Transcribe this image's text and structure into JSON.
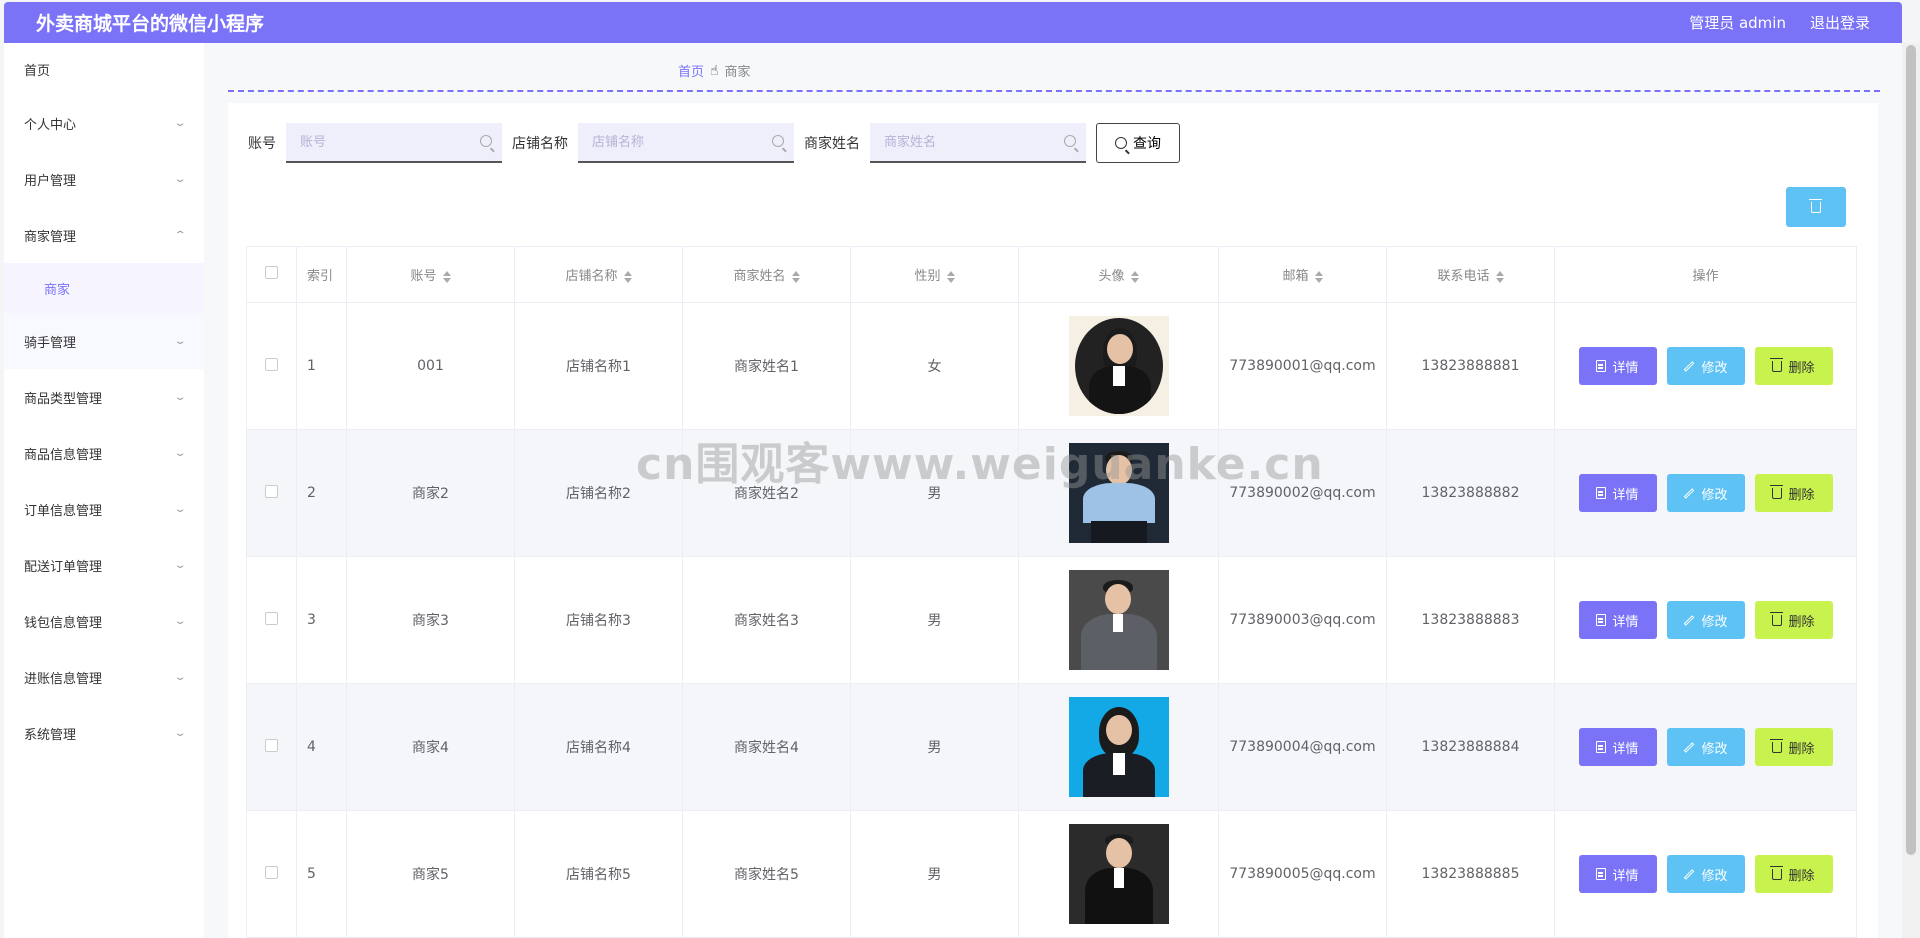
{
  "app": {
    "title": "外卖商城平台的微信小程序"
  },
  "header": {
    "user": "管理员 admin",
    "logout": "退出登录"
  },
  "sidebar": {
    "items": [
      {
        "label": "首页",
        "expandable": false
      },
      {
        "label": "个人中心",
        "expandable": true
      },
      {
        "label": "用户管理",
        "expandable": true
      },
      {
        "label": "商家管理",
        "expandable": true,
        "open": true,
        "children": [
          "商家"
        ]
      },
      {
        "label": "骑手管理",
        "expandable": true
      },
      {
        "label": "商品类型管理",
        "expandable": true
      },
      {
        "label": "商品信息管理",
        "expandable": true
      },
      {
        "label": "订单信息管理",
        "expandable": true
      },
      {
        "label": "配送订单管理",
        "expandable": true
      },
      {
        "label": "钱包信息管理",
        "expandable": true
      },
      {
        "label": "进账信息管理",
        "expandable": true
      },
      {
        "label": "系统管理",
        "expandable": true
      }
    ]
  },
  "breadcrumb": {
    "home": "首页",
    "current": "商家"
  },
  "search": {
    "account_label": "账号",
    "account_placeholder": "账号",
    "shop_label": "店铺名称",
    "shop_placeholder": "店铺名称",
    "name_label": "商家姓名",
    "name_placeholder": "商家姓名",
    "query_label": "查询"
  },
  "table": {
    "headers": [
      "索引",
      "账号",
      "店铺名称",
      "商家姓名",
      "性别",
      "头像",
      "邮箱",
      "联系电话",
      "操作"
    ],
    "rows": [
      {
        "index": "1",
        "account": "001",
        "shop": "店铺名称1",
        "name": "商家姓名1",
        "gender": "女",
        "email": "773890001@qq.com",
        "phone": "13823888881"
      },
      {
        "index": "2",
        "account": "商家2",
        "shop": "店铺名称2",
        "name": "商家姓名2",
        "gender": "男",
        "email": "773890002@qq.com",
        "phone": "13823888882"
      },
      {
        "index": "3",
        "account": "商家3",
        "shop": "店铺名称3",
        "name": "商家姓名3",
        "gender": "男",
        "email": "773890003@qq.com",
        "phone": "13823888883"
      },
      {
        "index": "4",
        "account": "商家4",
        "shop": "店铺名称4",
        "name": "商家姓名4",
        "gender": "男",
        "email": "773890004@qq.com",
        "phone": "13823888884"
      },
      {
        "index": "5",
        "account": "商家5",
        "shop": "店铺名称5",
        "name": "商家姓名5",
        "gender": "男",
        "email": "773890005@qq.com",
        "phone": "13823888885"
      }
    ],
    "actions": {
      "detail": "详情",
      "edit": "修改",
      "delete": "删除"
    }
  },
  "watermark": "cn围观客www.weiguanke.cn",
  "colors": {
    "primary": "#7a73f7",
    "info": "#5ec2f5",
    "lime": "#c8f24e"
  }
}
